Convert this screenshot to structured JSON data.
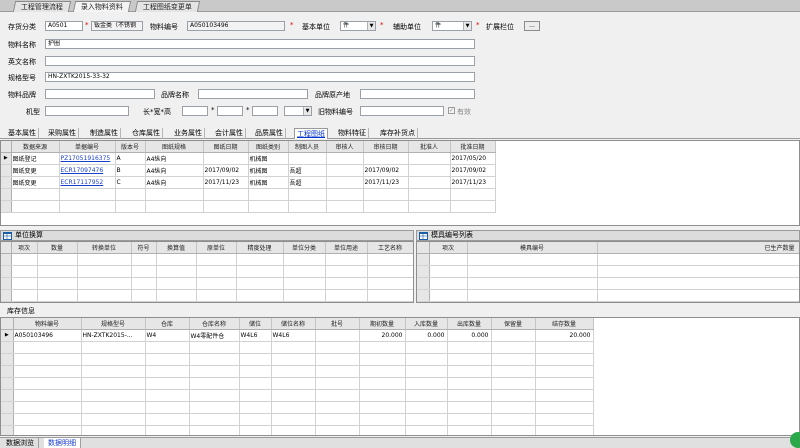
{
  "window_tabs": [
    "工程管理流程",
    "录入物料资料",
    "工程图纸变更单"
  ],
  "form": {
    "category_label": "存货分类",
    "category_code": "A0501",
    "category_name": "钣金类（不锈钢",
    "item_no_label": "物料编号",
    "item_no": "A050103496",
    "base_unit_label": "基本单位",
    "base_unit": "件",
    "aux_unit_label": "辅助单位",
    "aux_unit": "件",
    "ext_label": "扩展栏位",
    "ext_button": "...",
    "name_label": "物料名称",
    "name": "护圈",
    "en_name_label": "英文名称",
    "en_name": "",
    "spec_label": "规格型号",
    "spec": "HN-ZXTK2015-33-32",
    "brand_label": "物料品牌",
    "brand": "",
    "brand_name_label": "品牌名称",
    "brand_name": "",
    "origin_label": "品牌原产地",
    "origin": "",
    "model_label": "机型",
    "model": "",
    "dim_label": "长*宽*高",
    "dim_l": "",
    "dim_w": "",
    "dim_h": "",
    "old_no_label": "旧物料编号",
    "old_no": "",
    "valid_label": "有效",
    "star": "*",
    "check_mark": "✓"
  },
  "sub_tabs": [
    "基本属性",
    "采购属性",
    "制造属性",
    "仓库属性",
    "业务属性",
    "会计属性",
    "品质属性",
    "工程图纸",
    "物料特征",
    "库存补货点"
  ],
  "drawings": {
    "columns": [
      "数据来源",
      "单据编号",
      "版本号",
      "图纸规格",
      "图纸日期",
      "图纸类别",
      "制图人员",
      "审核人",
      "审核日期",
      "批准人",
      "批准日期"
    ],
    "rows": [
      [
        "图纸登记",
        "PZ17051916375",
        "A",
        "A4纵向",
        "",
        "机械图",
        "",
        "",
        "",
        "",
        "2017/05/20"
      ],
      [
        "图纸变更",
        "ECR17097476",
        "B",
        "A4纵向",
        "2017/09/02",
        "机械图",
        "吾超",
        "",
        "2017/09/02",
        "",
        "2017/09/02"
      ],
      [
        "图纸变更",
        "ECR17117952",
        "C",
        "A4纵向",
        "2017/11/23",
        "机械图",
        "吾超",
        "",
        "2017/11/23",
        "",
        "2017/11/23"
      ]
    ]
  },
  "units": {
    "title": "单位换算",
    "columns": [
      "项次",
      "数量",
      "转换单位",
      "符号",
      "换算值",
      "原单位",
      "精度处理",
      "单位分类",
      "单位用途",
      "工艺名称"
    ]
  },
  "molds": {
    "title": "模具编号列表",
    "columns": [
      "项次",
      "模具编号",
      "已生产数量"
    ]
  },
  "stock": {
    "title": "库存信息",
    "columns": [
      "物料编号",
      "规格型号",
      "仓库",
      "仓库名称",
      "储位",
      "储位名称",
      "批号",
      "期初数量",
      "入库数量",
      "出库数量",
      "保留量",
      "结存数量"
    ],
    "rows": [
      [
        "A050103496",
        "HN-ZXTK2015-...",
        "W4",
        "W4零配件仓",
        "W4L6",
        "W4L6",
        "",
        "20.000",
        "0.000",
        "0.000",
        "",
        "20.000"
      ]
    ]
  },
  "bottom_tabs": [
    "数据浏览",
    "数据明细"
  ],
  "colors": {
    "link": "#1a3ecc",
    "required": "#dd0000",
    "header_icon": "#1a5ea8"
  }
}
